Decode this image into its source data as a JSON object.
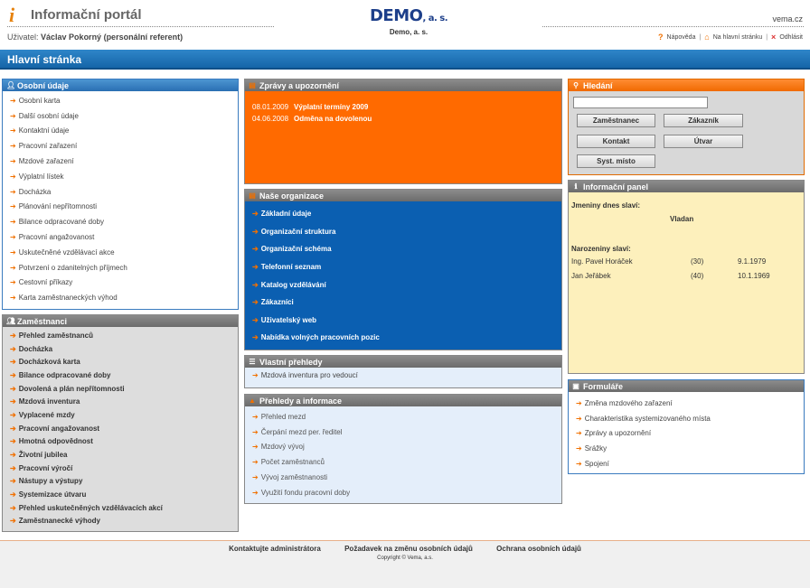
{
  "header": {
    "logo_icon": "i",
    "portal_title": "Informační portál",
    "user_label": "Uživatel:",
    "user_name": "Václav Pokorný (personální referent)",
    "brand_name": "DEMO",
    "brand_suffix": ", a. s.",
    "brand_subtitle": "Demo, a. s.",
    "site": "vema.cz",
    "links": {
      "help": "Nápověda",
      "home": "Na hlavní stránku",
      "logout": "Odhlásit"
    }
  },
  "page_title": "Hlavní stránka",
  "personal": {
    "title": "Osobní údaje",
    "items": [
      "Osobní karta",
      "Další osobní údaje",
      "Kontaktní údaje",
      "Pracovní zařazení",
      "Mzdové zařazení",
      "Výplatní lístek",
      "Docházka",
      "Plánování nepřítomnosti",
      "Bilance odpracované doby",
      "Pracovní angažovanost",
      "Uskutečněné vzdělávací akce",
      "Potvrzení o zdanitelných příjmech",
      "Cestovní příkazy",
      "Karta zaměstnaneckých výhod"
    ]
  },
  "employees": {
    "title": "Zaměstnanci",
    "items": [
      "Přehled zaměstnanců",
      "Docházka",
      "Docházková karta",
      "Bilance odpracované doby",
      "Dovolená a plán nepřítomnosti",
      "Mzdová inventura",
      "Vyplacené mzdy",
      "Pracovní angažovanost",
      "Hmotná odpovědnost",
      "Životní jubilea",
      "Pracovní výročí",
      "Nástupy a výstupy",
      "Systemizace útvaru",
      "Přehled uskutečněných vzdělávacích akcí",
      "Zaměstnanecké výhody"
    ]
  },
  "news": {
    "title": "Zprávy a upozornění",
    "items": [
      {
        "date": "08.01.2009",
        "text": "Výplatní termíny 2009"
      },
      {
        "date": "04.06.2008",
        "text": "Odměna na dovolenou"
      }
    ]
  },
  "org": {
    "title": "Naše organizace",
    "items": [
      "Základní údaje",
      "Organizační struktura",
      "Organizační schéma",
      "Telefonní seznam",
      "Katalog vzdělávání",
      "Zákazníci",
      "Uživatelský web",
      "Nabídka volných pracovních pozic"
    ]
  },
  "own": {
    "title": "Vlastní přehledy",
    "items": [
      "Mzdová inventura pro vedoucí"
    ]
  },
  "reports": {
    "title": "Přehledy a informace",
    "items": [
      "Přehled mezd",
      "Čerpání mezd per. ředitel",
      "Mzdový vývoj",
      "Počet zaměstnanců",
      "Vývoj zaměstnanosti",
      "Využití fondu pracovní doby"
    ]
  },
  "search": {
    "title": "Hledání",
    "value": "",
    "buttons": [
      "Zaměstnanec",
      "Zákazník",
      "Kontakt",
      "Útvar",
      "Syst. místo"
    ]
  },
  "info": {
    "title": "Informační panel",
    "names_label": "Jmeniny dnes slaví:",
    "names_value": "Vladan",
    "birthdays_label": "Narozeniny slaví:",
    "birthdays": [
      {
        "name": "Ing. Pavel Horáček",
        "age": "(30)",
        "date": "9.1.1979"
      },
      {
        "name": "Jan Jeřábek",
        "age": "(40)",
        "date": "10.1.1969"
      }
    ]
  },
  "forms": {
    "title": "Formuláře",
    "items": [
      "Změna mzdového zařazení",
      "Charakteristika systemizovaného místa",
      "Zprávy a upozornění",
      "Srážky",
      "Spojení"
    ]
  },
  "footer": {
    "links": [
      "Kontaktujte administrátora",
      "Požadavek na změnu osobních údajů",
      "Ochrana osobních údajů"
    ],
    "copyright": "Copyright © Vema, a.s."
  },
  "colors": {
    "accent_blue": "#1565a8",
    "org_blue": "#0b5fb1",
    "news_orange": "#ff6a00",
    "info_yellow": "#fdf0bc",
    "arrow_orange": "#f07000"
  }
}
